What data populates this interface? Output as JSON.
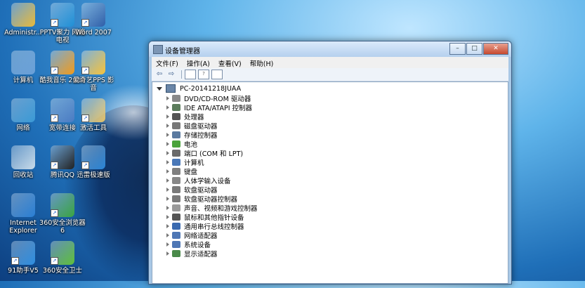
{
  "desktop": {
    "icons": [
      {
        "label": "Administr...",
        "color": "#e8b93a"
      },
      {
        "label": "PPTV聚力 网络电视",
        "color": "#1e8fd6"
      },
      {
        "label": "Word 2007",
        "color": "#2f5ea8"
      },
      {
        "label": "计算机",
        "color": "#6aa0d8"
      },
      {
        "label": "酷我音乐 2014",
        "color": "#f29a1a"
      },
      {
        "label": "爱奇艺PPS 影音",
        "color": "#f7c23b"
      },
      {
        "label": "网络",
        "color": "#3a9ad6"
      },
      {
        "label": "宽带连接",
        "color": "#4a7bc3"
      },
      {
        "label": "激活工具",
        "color": "#e3c26a"
      },
      {
        "label": "回收站",
        "color": "#c9dbe9"
      },
      {
        "label": "腾讯QQ",
        "color": "#222222"
      },
      {
        "label": "迅雷极速版",
        "color": "#2a86d8"
      },
      {
        "label": "Internet Explorer",
        "color": "#2a7fd4"
      },
      {
        "label": "360安全浏览器6",
        "color": "#3aa541"
      },
      {
        "label": "91助手V5",
        "color": "#2e8ee0"
      },
      {
        "label": "360安全卫士",
        "color": "#5fbf3a"
      }
    ]
  },
  "window": {
    "title": "设备管理器",
    "buttons": {
      "minimize": "–",
      "maximize": "□",
      "close": "✕"
    },
    "menu": [
      "文件(F)",
      "操作(A)",
      "查看(V)",
      "帮助(H)"
    ],
    "toolbar": {
      "back": "⇦",
      "forward": "⇨"
    },
    "tree": {
      "root": "PC-20141218JUAA",
      "items": [
        {
          "label": "DVD/CD-ROM 驱动器",
          "color": "#8a8a8a"
        },
        {
          "label": "IDE ATA/ATAPI 控制器",
          "color": "#5c7c5c"
        },
        {
          "label": "处理器",
          "color": "#555555"
        },
        {
          "label": "磁盘驱动器",
          "color": "#777777"
        },
        {
          "label": "存储控制器",
          "color": "#5a7aa0"
        },
        {
          "label": "电池",
          "color": "#4aa33a"
        },
        {
          "label": "端口 (COM 和 LPT)",
          "color": "#6a6a6a"
        },
        {
          "label": "计算机",
          "color": "#4a78b8"
        },
        {
          "label": "键盘",
          "color": "#808080"
        },
        {
          "label": "人体学输入设备",
          "color": "#888888"
        },
        {
          "label": "软盘驱动器",
          "color": "#7a7a7a"
        },
        {
          "label": "软盘驱动器控制器",
          "color": "#7a7a7a"
        },
        {
          "label": "声音、视频和游戏控制器",
          "color": "#9a9a9a"
        },
        {
          "label": "鼠标和其他指针设备",
          "color": "#555555"
        },
        {
          "label": "通用串行总线控制器",
          "color": "#3a6ab0"
        },
        {
          "label": "网络适配器",
          "color": "#4f77b5"
        },
        {
          "label": "系统设备",
          "color": "#4f77b5"
        },
        {
          "label": "显示适配器",
          "color": "#4a8a4a"
        }
      ]
    }
  }
}
